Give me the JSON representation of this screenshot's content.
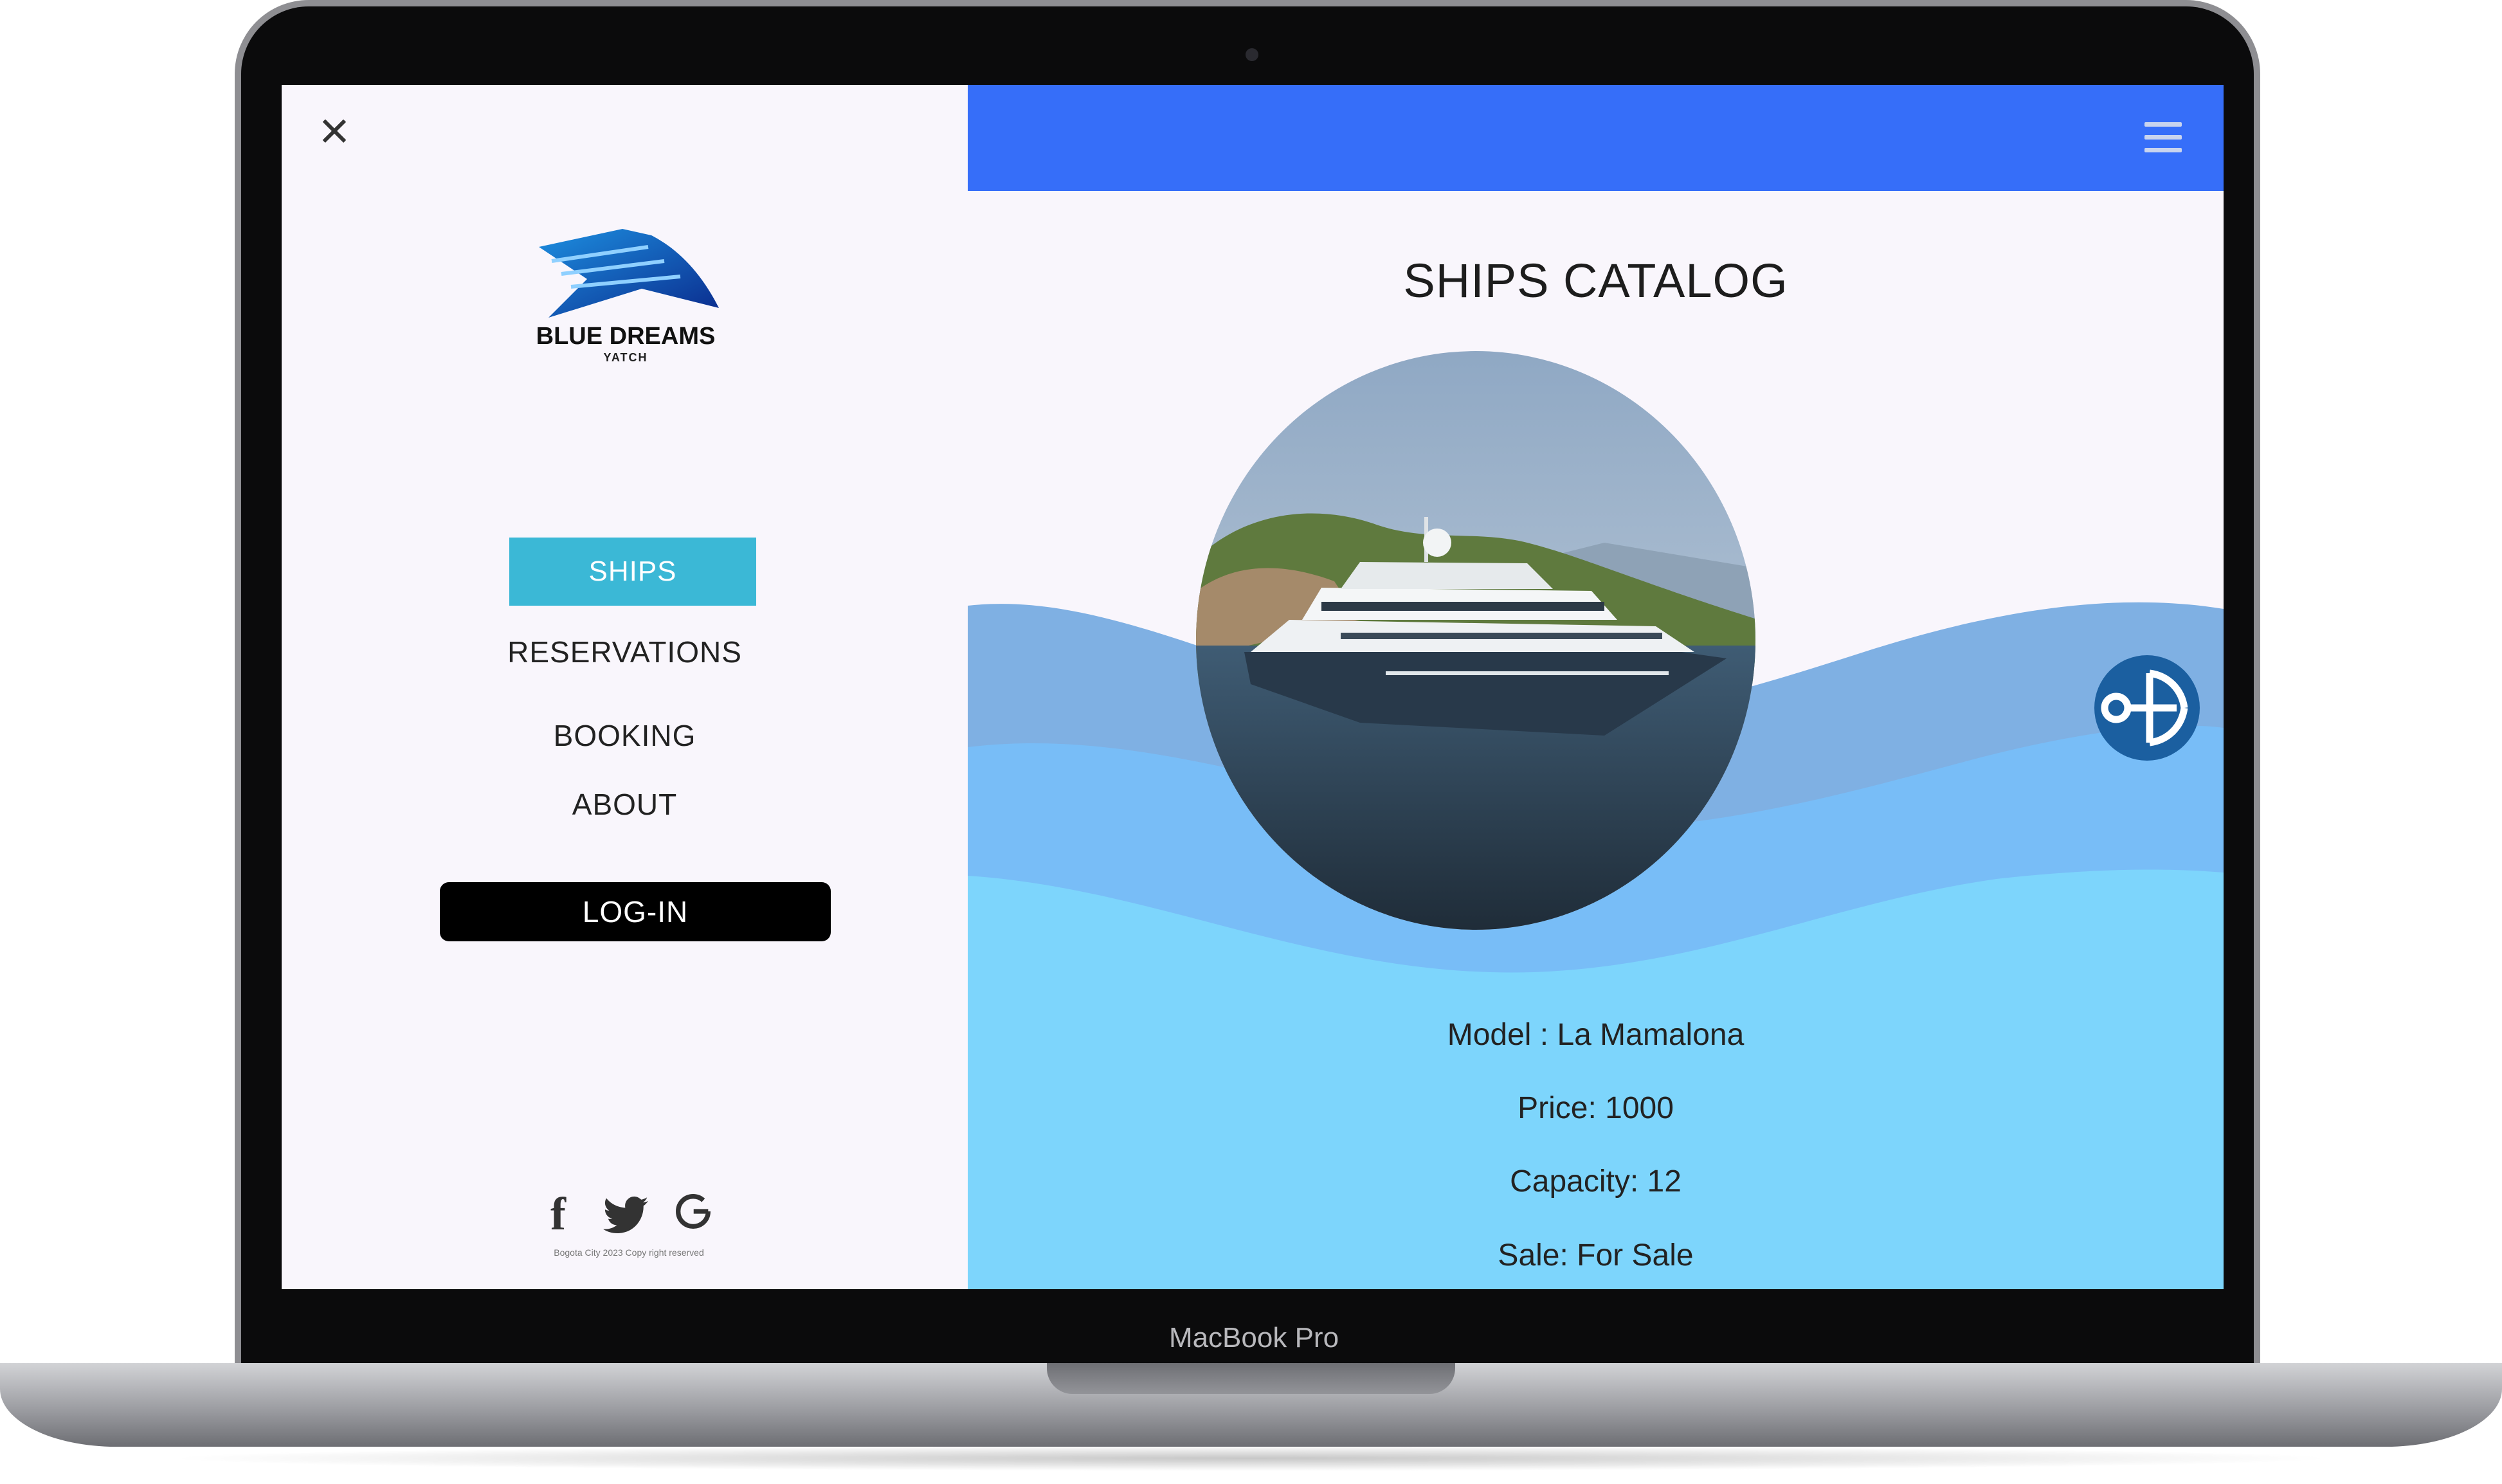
{
  "device": {
    "label": "MacBook Pro"
  },
  "sidebar": {
    "logo": {
      "name": "BLUE DREAMS",
      "subtitle": "YATCH"
    },
    "nav": [
      {
        "label": "SHIPS",
        "active": true
      },
      {
        "label": "RESERVATIONS"
      },
      {
        "label": "BOOKING"
      },
      {
        "label": "ABOUT"
      }
    ],
    "login_label": "LOG-IN",
    "social": [
      "facebook-icon",
      "twitter-icon",
      "google-icon"
    ],
    "footer": "Bogota City 2023 Copy right reserved"
  },
  "main": {
    "title": "SHIPS CATALOG",
    "details": [
      "Model : La Mamalona",
      "Price: 1000",
      "Capacity:  12",
      "Sale: For Sale"
    ]
  },
  "colors": {
    "topbar": "#366ef9",
    "nav_active": "#3bb8d6",
    "wave_back": "#7fb0e3",
    "wave_mid": "#78bdf7",
    "wave_front": "#7dd5fc",
    "anchor": "#1b5fa0"
  }
}
